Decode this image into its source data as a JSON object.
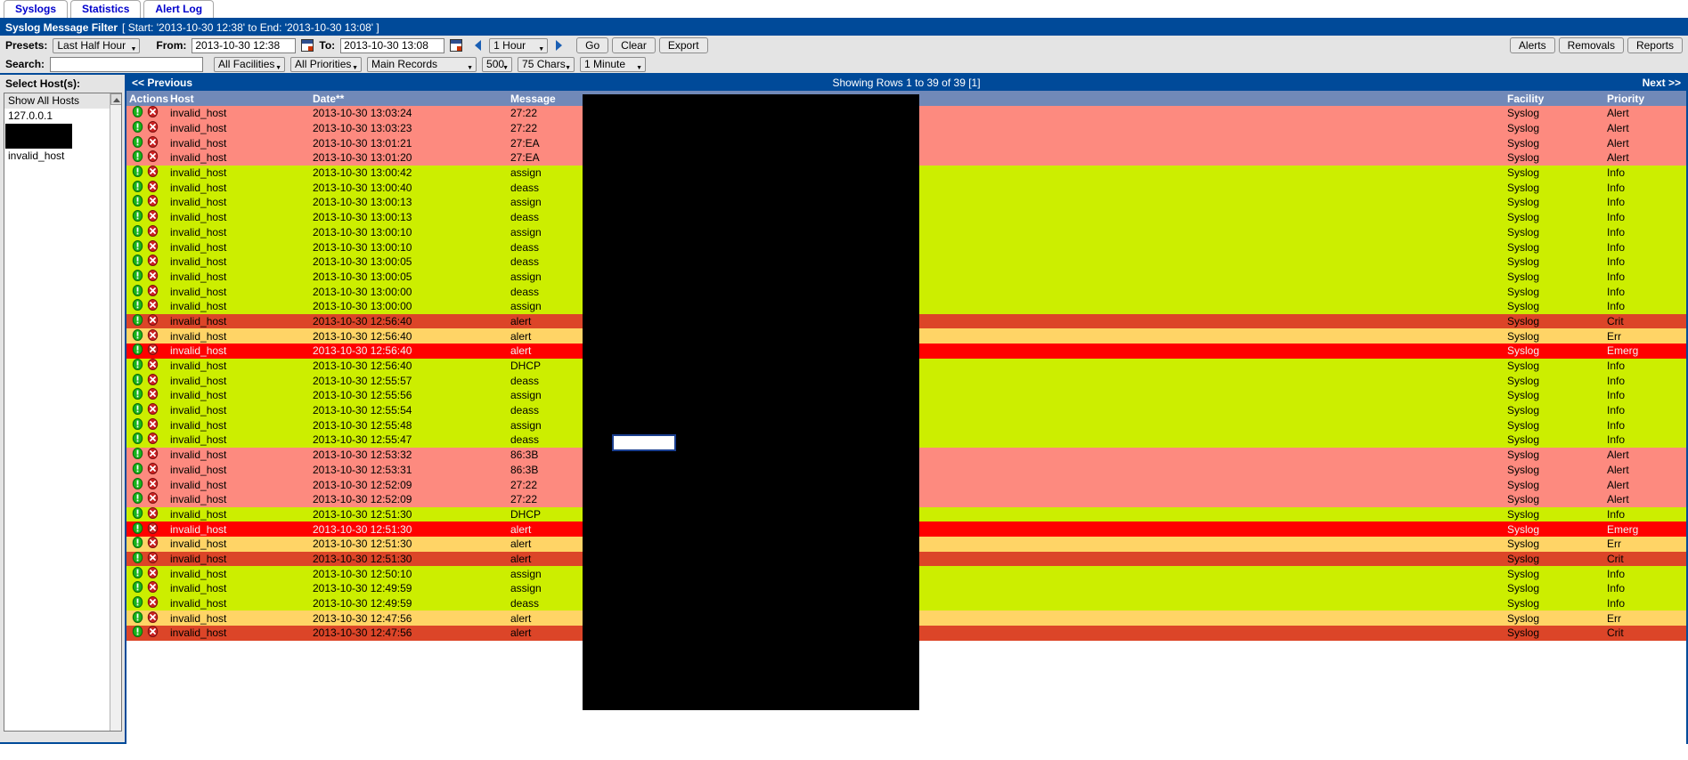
{
  "tabs": [
    {
      "label": "Syslogs",
      "name": "tab-syslogs"
    },
    {
      "label": "Statistics",
      "name": "tab-statistics"
    },
    {
      "label": "Alert Log",
      "name": "tab-alert-log"
    }
  ],
  "filter_bar": {
    "title": "Syslog Message Filter",
    "range": "[ Start: '2013-10-30 12:38' to End: '2013-10-30 13:08' ]"
  },
  "controls": {
    "presets_label": "Presets:",
    "presets_value": "Last Half Hour",
    "from_label": "From:",
    "from_value": "2013-10-30 12:38",
    "to_label": "To:",
    "to_value": "2013-10-30 13:08",
    "interval_value": "1 Hour",
    "go_label": "Go",
    "clear_label": "Clear",
    "export_label": "Export",
    "alerts_label": "Alerts",
    "removals_label": "Removals",
    "reports_label": "Reports",
    "search_label": "Search:",
    "search_value": "",
    "search_placeholder": "",
    "facilities_value": "All Facilities",
    "priorities_value": "All Priorities",
    "records_value": "Main Records",
    "limit_value": "500",
    "chars_value": "75 Chars",
    "refresh_value": "1 Minute",
    "accent_color": "#004a99"
  },
  "hosts": {
    "title": "Select Host(s):",
    "items": [
      {
        "label": "Show All Hosts",
        "selected": true,
        "redacted": false
      },
      {
        "label": "127.0.0.1",
        "selected": false,
        "redacted": false
      },
      {
        "label": "",
        "selected": false,
        "redacted": true
      },
      {
        "label": "invalid_host",
        "selected": false,
        "redacted": false
      }
    ]
  },
  "pager": {
    "previous_label": "<< Previous",
    "showing_label": "Showing Rows 1 to 39 of 39 [1]",
    "next_label": "Next >>"
  },
  "table": {
    "columns": [
      "Actions",
      "Host",
      "Date**",
      "Message",
      "Facility",
      "Priority"
    ],
    "rows": [
      {
        "host": "invalid_host",
        "date": "2013-10-30 13:03:24",
        "message": "27:22",
        "facility": "Syslog",
        "priority": "Alert"
      },
      {
        "host": "invalid_host",
        "date": "2013-10-30 13:03:23",
        "message": "27:22",
        "facility": "Syslog",
        "priority": "Alert"
      },
      {
        "host": "invalid_host",
        "date": "2013-10-30 13:01:21",
        "message": "27:EA",
        "facility": "Syslog",
        "priority": "Alert"
      },
      {
        "host": "invalid_host",
        "date": "2013-10-30 13:01:20",
        "message": "27:EA",
        "facility": "Syslog",
        "priority": "Alert"
      },
      {
        "host": "invalid_host",
        "date": "2013-10-30 13:00:42",
        "message": "assign",
        "facility": "Syslog",
        "priority": "Info"
      },
      {
        "host": "invalid_host",
        "date": "2013-10-30 13:00:40",
        "message": "deass",
        "facility": "Syslog",
        "priority": "Info"
      },
      {
        "host": "invalid_host",
        "date": "2013-10-30 13:00:13",
        "message": "assign",
        "facility": "Syslog",
        "priority": "Info"
      },
      {
        "host": "invalid_host",
        "date": "2013-10-30 13:00:13",
        "message": "deass",
        "facility": "Syslog",
        "priority": "Info"
      },
      {
        "host": "invalid_host",
        "date": "2013-10-30 13:00:10",
        "message": "assign",
        "facility": "Syslog",
        "priority": "Info"
      },
      {
        "host": "invalid_host",
        "date": "2013-10-30 13:00:10",
        "message": "deass",
        "facility": "Syslog",
        "priority": "Info"
      },
      {
        "host": "invalid_host",
        "date": "2013-10-30 13:00:05",
        "message": "deass",
        "facility": "Syslog",
        "priority": "Info"
      },
      {
        "host": "invalid_host",
        "date": "2013-10-30 13:00:05",
        "message": "assign",
        "facility": "Syslog",
        "priority": "Info"
      },
      {
        "host": "invalid_host",
        "date": "2013-10-30 13:00:00",
        "message": "deass",
        "facility": "Syslog",
        "priority": "Info"
      },
      {
        "host": "invalid_host",
        "date": "2013-10-30 13:00:00",
        "message": "assign",
        "facility": "Syslog",
        "priority": "Info"
      },
      {
        "host": "invalid_host",
        "date": "2013-10-30 12:56:40",
        "message": "alert",
        "facility": "Syslog",
        "priority": "Crit"
      },
      {
        "host": "invalid_host",
        "date": "2013-10-30 12:56:40",
        "message": "alert",
        "facility": "Syslog",
        "priority": "Err"
      },
      {
        "host": "invalid_host",
        "date": "2013-10-30 12:56:40",
        "message": "alert",
        "facility": "Syslog",
        "priority": "Emerg"
      },
      {
        "host": "invalid_host",
        "date": "2013-10-30 12:56:40",
        "message": "DHCP",
        "facility": "Syslog",
        "priority": "Info"
      },
      {
        "host": "invalid_host",
        "date": "2013-10-30 12:55:57",
        "message": "deass",
        "facility": "Syslog",
        "priority": "Info"
      },
      {
        "host": "invalid_host",
        "date": "2013-10-30 12:55:56",
        "message": "assign",
        "facility": "Syslog",
        "priority": "Info"
      },
      {
        "host": "invalid_host",
        "date": "2013-10-30 12:55:54",
        "message": "deass",
        "facility": "Syslog",
        "priority": "Info"
      },
      {
        "host": "invalid_host",
        "date": "2013-10-30 12:55:48",
        "message": "assign",
        "facility": "Syslog",
        "priority": "Info"
      },
      {
        "host": "invalid_host",
        "date": "2013-10-30 12:55:47",
        "message": "deass",
        "facility": "Syslog",
        "priority": "Info"
      },
      {
        "host": "invalid_host",
        "date": "2013-10-30 12:53:32",
        "message": "86:3B",
        "facility": "Syslog",
        "priority": "Alert"
      },
      {
        "host": "invalid_host",
        "date": "2013-10-30 12:53:31",
        "message": "86:3B",
        "facility": "Syslog",
        "priority": "Alert"
      },
      {
        "host": "invalid_host",
        "date": "2013-10-30 12:52:09",
        "message": "27:22",
        "facility": "Syslog",
        "priority": "Alert"
      },
      {
        "host": "invalid_host",
        "date": "2013-10-30 12:52:09",
        "message": "27:22",
        "facility": "Syslog",
        "priority": "Alert"
      },
      {
        "host": "invalid_host",
        "date": "2013-10-30 12:51:30",
        "message": "DHCP",
        "facility": "Syslog",
        "priority": "Info"
      },
      {
        "host": "invalid_host",
        "date": "2013-10-30 12:51:30",
        "message": "alert",
        "facility": "Syslog",
        "priority": "Emerg"
      },
      {
        "host": "invalid_host",
        "date": "2013-10-30 12:51:30",
        "message": "alert",
        "facility": "Syslog",
        "priority": "Err"
      },
      {
        "host": "invalid_host",
        "date": "2013-10-30 12:51:30",
        "message": "alert",
        "facility": "Syslog",
        "priority": "Crit"
      },
      {
        "host": "invalid_host",
        "date": "2013-10-30 12:50:10",
        "message": "assign",
        "facility": "Syslog",
        "priority": "Info"
      },
      {
        "host": "invalid_host",
        "date": "2013-10-30 12:49:59",
        "message": "assign",
        "facility": "Syslog",
        "priority": "Info"
      },
      {
        "host": "invalid_host",
        "date": "2013-10-30 12:49:59",
        "message": "deass",
        "facility": "Syslog",
        "priority": "Info"
      },
      {
        "host": "invalid_host",
        "date": "2013-10-30 12:47:56",
        "message": "alert",
        "facility": "Syslog",
        "priority": "Err"
      },
      {
        "host": "invalid_host",
        "date": "2013-10-30 12:47:56",
        "message": "alert",
        "facility": "Syslog",
        "priority": "Crit"
      }
    ]
  },
  "icons": {
    "info_action": "info-circle-icon",
    "delete_action": "delete-x-icon"
  }
}
